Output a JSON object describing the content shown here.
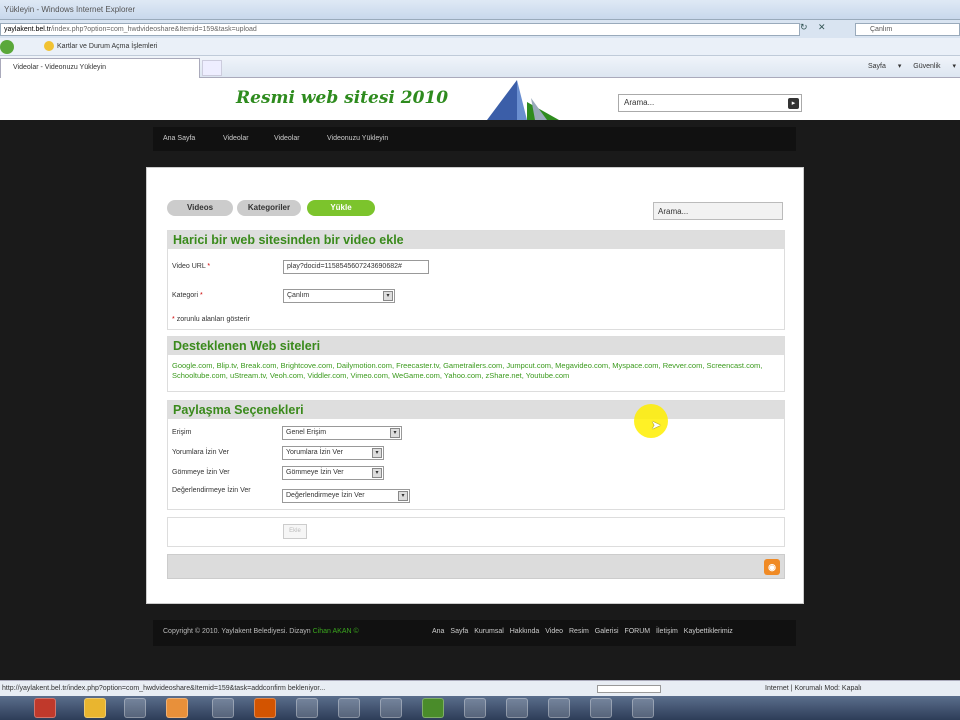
{
  "browser": {
    "title": "Yükleyin - Windows Internet Explorer",
    "url_host": "yaylakent.bel.tr",
    "url_path": "/index.php?option=com_hwdvideoshare&Itemid=159&task=upload",
    "search_placeholder": "Çanlım",
    "favorite": "Kartlar ve Durum Açma İşlemleri",
    "tab_title": "Videolar - Videonuzu Yükleyin",
    "tools": "Sayfa ▾   Güvenlik ▾",
    "status_text": "http://yaylakent.bel.tr/index.php?option=com_hwdvideoshare&Itemid=159&task=addconfirm bekleniyor...",
    "zone_text": "Internet | Korumalı Mod: Kapalı"
  },
  "site": {
    "logo_text": "Resmi web sitesi 2010",
    "search_placeholder": "Arama..."
  },
  "topnav": [
    "Ana Sayfa",
    "Videolar",
    "Videolar",
    "Videonuzu Yükleyin"
  ],
  "tabs": [
    "Videos",
    "Kategoriler",
    "Yükle"
  ],
  "content_search_placeholder": "Arama...",
  "external_section": {
    "title": "Harici bir web sitesinden bir video ekle",
    "video_url_label": "Video URL",
    "video_url_value": "play?docid=1158545607243690682#",
    "category_label": "Kategori",
    "category_value": "Çanlım",
    "required_star": "*",
    "required_note": "zorunlu alanları gösterir"
  },
  "supported_section": {
    "title": "Desteklenen Web siteleri",
    "sites": "Google.com, Blip.tv, Break.com, Brightcove.com, Dailymotion.com, Freecaster.tv, Gametrailers.com, Jumpcut.com, Megavideo.com, Myspace.com, Revver.com, Screencast.com, Schooltube.com, uStream.tv, Veoh.com, Viddler.com, Vimeo.com, WeGame.com, Yahoo.com, zShare.net, Youtube.com"
  },
  "sharing_section": {
    "title": "Paylaşma Seçenekleri",
    "rows": [
      {
        "label": "Erişim",
        "value": "Genel Erişim"
      },
      {
        "label": "Yorumlara İzin Ver",
        "value": "Yorumlara İzin Ver"
      },
      {
        "label": "Gömmeye İzin Ver",
        "value": "Gömmeye İzin Ver"
      },
      {
        "label": "Değerlendirmeye İzin Ver",
        "value": "Değerlendirmeye İzin Ver"
      }
    ]
  },
  "submit_label": "Ekle",
  "footer": {
    "copyright": "Copyright © 2010. Yaylakent Belediyesi. Dizayn",
    "designer": "Cihan AKAN ©",
    "links": "Ana Sayfa  Kurumsal  Hakkında  Video  Resim Galerisi  FORUM  İletişim  Kaybettiklerimiz"
  },
  "colors": {
    "accent_green": "#3a8a1c",
    "tab_active": "#7cc42c",
    "cursor_highlight": "#ffee00"
  }
}
